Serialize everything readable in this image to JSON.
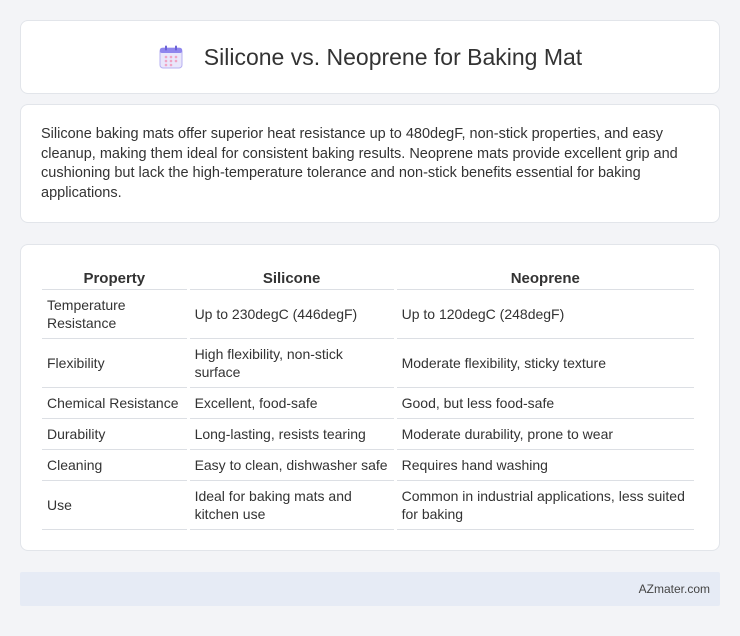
{
  "header": {
    "icon": "calendar-icon",
    "title": "Silicone vs. Neoprene for Baking Mat"
  },
  "intro": {
    "text": "Silicone baking mats offer superior heat resistance up to 480degF, non-stick properties, and easy cleanup, making them ideal for consistent baking results. Neoprene mats provide excellent grip and cushioning but lack the high-temperature tolerance and non-stick benefits essential for baking applications."
  },
  "table": {
    "headers": [
      "Property",
      "Silicone",
      "Neoprene"
    ],
    "rows": [
      [
        "Temperature Resistance",
        "Up to 230degC (446degF)",
        "Up to 120degC (248degF)"
      ],
      [
        "Flexibility",
        "High flexibility, non-stick surface",
        "Moderate flexibility, sticky texture"
      ],
      [
        "Chemical Resistance",
        "Excellent, food-safe",
        "Good, but less food-safe"
      ],
      [
        "Durability",
        "Long-lasting, resists tearing",
        "Moderate durability, prone to wear"
      ],
      [
        "Cleaning",
        "Easy to clean, dishwasher safe",
        "Requires hand washing"
      ],
      [
        "Use",
        "Ideal for baking mats and kitchen use",
        "Common in industrial applications, less suited for baking"
      ]
    ]
  },
  "footer": {
    "text": "AZmater.com"
  },
  "colors": {
    "background": "#f3f4f7",
    "card": "#ffffff",
    "footer": "#e6ebf5",
    "icon_accent": "#8a7ff0"
  }
}
